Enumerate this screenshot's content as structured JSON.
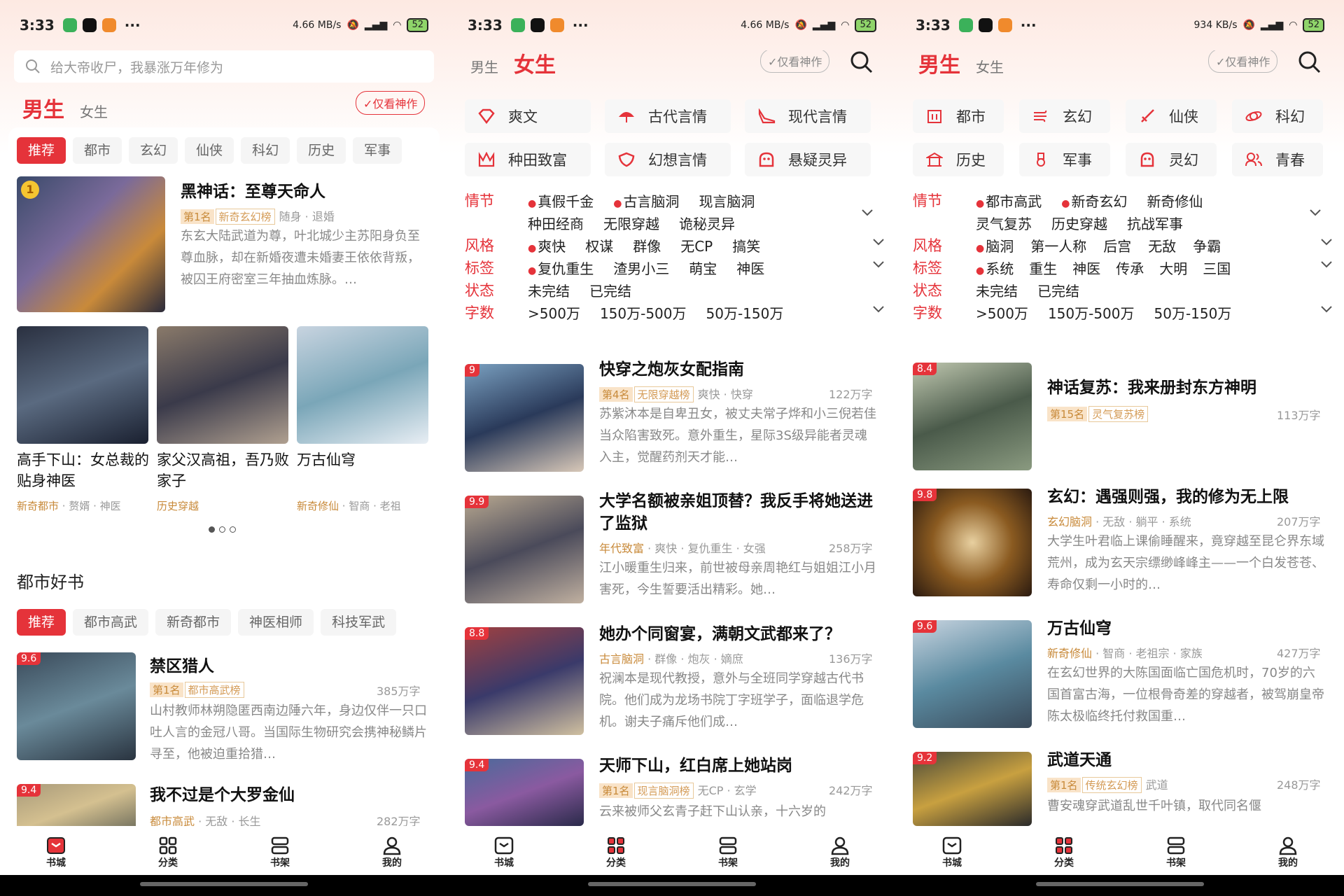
{
  "status": {
    "p1": {
      "time": "3:33",
      "net": "4.66 MB/s",
      "battery": "52"
    },
    "p2": {
      "time": "3:33",
      "net": "4.66 MB/s",
      "battery": "52"
    },
    "p3": {
      "time": "3:33",
      "net": "934 KB/s",
      "battery": "52"
    }
  },
  "colors": {
    "accent": "#e5333a",
    "tag_bg": "#f9e3c8",
    "tag_fg": "#c88a3a"
  },
  "p1": {
    "search_placeholder": "给大帝收尸，我暴涨万年修为",
    "gender_tabs": [
      "男生",
      "女生"
    ],
    "only_masterpiece": "✓仅看神作",
    "chips": [
      "推荐",
      "都市",
      "玄幻",
      "仙侠",
      "科幻",
      "历史",
      "军事"
    ],
    "featured": {
      "rank_badge": "1",
      "title": "黑神话：至尊天命人",
      "rank_tag": "第1名",
      "list_tag": "新奇玄幻榜",
      "tags": "随身 · 退婚",
      "desc": "东玄大陆武道为尊，叶北城少主苏阳身负至尊血脉，却在新婚夜遭未婚妻王依依背叛，被囚王府密室三年抽血炼脉。…"
    },
    "grid": [
      {
        "title": "高手下山：女总裁的贴身神医",
        "meta_hl": "新奇都市",
        "meta": " · 赘婿 · 神医"
      },
      {
        "title": "家父汉高祖，吾乃败家子",
        "meta_hl": "历史穿越",
        "meta": ""
      },
      {
        "title": "万古仙穹",
        "meta_hl": "新奇修仙",
        "meta": " · 智商 · 老祖"
      }
    ],
    "section_title": "都市好书",
    "section_chips": [
      "推荐",
      "都市高武",
      "新奇都市",
      "神医相师",
      "科技军武"
    ],
    "books": [
      {
        "score": "9.6",
        "title": "禁区猎人",
        "rank_tag": "第1名",
        "list_tag": "都市高武榜",
        "words": "385万字",
        "desc": "山村教师林朔隐匿西南边陲六年，身边仅伴一只口吐人言的金冠八哥。当国际生物研究会携神秘鳞片寻至，他被迫重拾猎…"
      },
      {
        "score": "9.4",
        "title": "我不过是个大罗金仙",
        "meta_hl": "都市高武",
        "meta": " · 无敌 · 长生",
        "words": "282万字"
      }
    ]
  },
  "p2": {
    "gender_tabs": [
      "男生",
      "女生"
    ],
    "only_masterpiece": "✓仅看神作",
    "categories": [
      {
        "icon": "diamond-icon",
        "label": "爽文"
      },
      {
        "icon": "umbrella-icon",
        "label": "古代言情"
      },
      {
        "icon": "heel-icon",
        "label": "现代言情"
      },
      {
        "icon": "crown-icon",
        "label": "种田致富"
      },
      {
        "icon": "shield-icon",
        "label": "幻想言情"
      },
      {
        "icon": "ghost-icon",
        "label": "悬疑灵异"
      }
    ],
    "filters": [
      {
        "label": "情节",
        "rows": [
          [
            {
              "t": "真假千金",
              "hot": true
            },
            {
              "t": "古言脑洞",
              "hot": true
            },
            {
              "t": "现言脑洞"
            }
          ],
          [
            {
              "t": "种田经商"
            },
            {
              "t": "无限穿越"
            },
            {
              "t": "诡秘灵异"
            }
          ]
        ]
      },
      {
        "label": "风格",
        "rows": [
          [
            {
              "t": "爽快",
              "hot": true
            },
            {
              "t": "权谋"
            },
            {
              "t": "群像"
            },
            {
              "t": "无CP"
            },
            {
              "t": "搞笑"
            }
          ]
        ]
      },
      {
        "label": "标签",
        "rows": [
          [
            {
              "t": "复仇重生",
              "hot": true
            },
            {
              "t": "渣男小三"
            },
            {
              "t": "萌宝"
            },
            {
              "t": "神医"
            }
          ]
        ]
      },
      {
        "label": "状态",
        "rows": [
          [
            {
              "t": "未完结"
            },
            {
              "t": "已完结"
            }
          ]
        ]
      },
      {
        "label": "字数",
        "rows": [
          [
            {
              "t": ">500万"
            },
            {
              "t": "150万-500万"
            },
            {
              "t": "50万-150万"
            }
          ]
        ]
      }
    ],
    "books": [
      {
        "score": "9",
        "title": "快穿之炮灰女配指南",
        "rank_tag": "第4名",
        "list_tag": "无限穿越榜",
        "tags": "爽快 · 快穿",
        "words": "122万字",
        "desc": "苏紫沐本是自卑丑女，被丈夫常子烨和小三倪若佳当众陷害致死。意外重生，星际3S级异能者灵魂入主，觉醒药剂天才能…"
      },
      {
        "score": "9.9",
        "title": "大学名额被亲姐顶替？我反手将她送进了监狱",
        "meta_hl": "年代致富",
        "meta": " · 爽快 · 复仇重生 · 女强",
        "words": "258万字",
        "desc": "江小暖重生归来，前世被母亲周艳红与姐姐江小月害死，今生誓要活出精彩。她…"
      },
      {
        "score": "8.8",
        "title": "她办个同窗宴，满朝文武都来了？",
        "meta_hl": "古言脑洞",
        "meta": " · 群像 · 炮灰 · 嫡庶",
        "words": "136万字",
        "desc": "祝澜本是现代教授，意外与全班同学穿越古代书院。他们成为龙场书院丁字班学子，面临退学危机。谢夫子痛斥他们成…"
      },
      {
        "score": "9.4",
        "title": "天师下山，红白席上她站岗",
        "rank_tag": "第1名",
        "list_tag": "现言脑洞榜",
        "tags": "无CP · 玄学",
        "words": "242万字",
        "desc": "云来被师父玄青子赶下山认亲，十六岁的"
      }
    ]
  },
  "p3": {
    "gender_tabs": [
      "男生",
      "女生"
    ],
    "only_masterpiece": "✓仅看神作",
    "categories": [
      {
        "icon": "building-icon",
        "label": "都市"
      },
      {
        "icon": "wind-icon",
        "label": "玄幻"
      },
      {
        "icon": "sword-icon",
        "label": "仙侠"
      },
      {
        "icon": "planet-icon",
        "label": "科幻"
      },
      {
        "icon": "temple-icon",
        "label": "历史"
      },
      {
        "icon": "medal-icon",
        "label": "军事"
      },
      {
        "icon": "ghost-icon",
        "label": "灵幻"
      },
      {
        "icon": "people-icon",
        "label": "青春"
      }
    ],
    "filters": [
      {
        "label": "情节",
        "rows": [
          [
            {
              "t": "都市高武",
              "hot": true
            },
            {
              "t": "新奇玄幻",
              "hot": true
            },
            {
              "t": "新奇修仙"
            }
          ],
          [
            {
              "t": "灵气复苏"
            },
            {
              "t": "历史穿越"
            },
            {
              "t": "抗战军事"
            }
          ]
        ]
      },
      {
        "label": "风格",
        "rows": [
          [
            {
              "t": "脑洞",
              "hot": true
            },
            {
              "t": "第一人称"
            },
            {
              "t": "后宫"
            },
            {
              "t": "无敌"
            },
            {
              "t": "争霸"
            }
          ]
        ]
      },
      {
        "label": "标签",
        "rows": [
          [
            {
              "t": "系统",
              "hot": true
            },
            {
              "t": "重生"
            },
            {
              "t": "神医"
            },
            {
              "t": "传承"
            },
            {
              "t": "大明"
            },
            {
              "t": "三国"
            }
          ]
        ]
      },
      {
        "label": "状态",
        "rows": [
          [
            {
              "t": "未完结"
            },
            {
              "t": "已完结"
            }
          ]
        ]
      },
      {
        "label": "字数",
        "rows": [
          [
            {
              "t": ">500万"
            },
            {
              "t": "150万-500万"
            },
            {
              "t": "50万-150万"
            }
          ]
        ]
      }
    ],
    "books": [
      {
        "score": "8.4",
        "title": "神话复苏：我来册封东方神明",
        "rank_tag": "第15名",
        "list_tag": "灵气复苏榜",
        "words": "113万字",
        "desc": ""
      },
      {
        "score": "9.8",
        "title": "玄幻：遇强则强，我的修为无上限",
        "meta_hl": "玄幻脑洞",
        "meta": " · 无敌 · 躺平 · 系统",
        "words": "207万字",
        "desc": "大学生叶君临上课偷睡醒来，竟穿越至昆仑界东域荒州，成为玄天宗缥缈峰峰主——一个白发苍苍、寿命仅剩一小时的…"
      },
      {
        "score": "9.6",
        "title": "万古仙穹",
        "meta_hl": "新奇修仙",
        "meta": " · 智商 · 老祖宗 · 家族",
        "words": "427万字",
        "desc": "在玄幻世界的大陈国面临亡国危机时，70岁的六国首富古海，一位根骨奇差的穿越者，被驾崩皇帝陈太极临终托付救国重…"
      },
      {
        "score": "9.2",
        "title": "武道天通",
        "rank_tag": "第1名",
        "list_tag": "传统玄幻榜",
        "tags": "武道",
        "words": "248万字",
        "desc": "曹安魂穿武道乱世千叶镇，取代同名偃"
      }
    ]
  },
  "nav": [
    {
      "icon": "bookstore-icon",
      "label": "书城"
    },
    {
      "icon": "category-icon",
      "label": "分类"
    },
    {
      "icon": "bookshelf-icon",
      "label": "书架"
    },
    {
      "icon": "profile-icon",
      "label": "我的"
    }
  ]
}
